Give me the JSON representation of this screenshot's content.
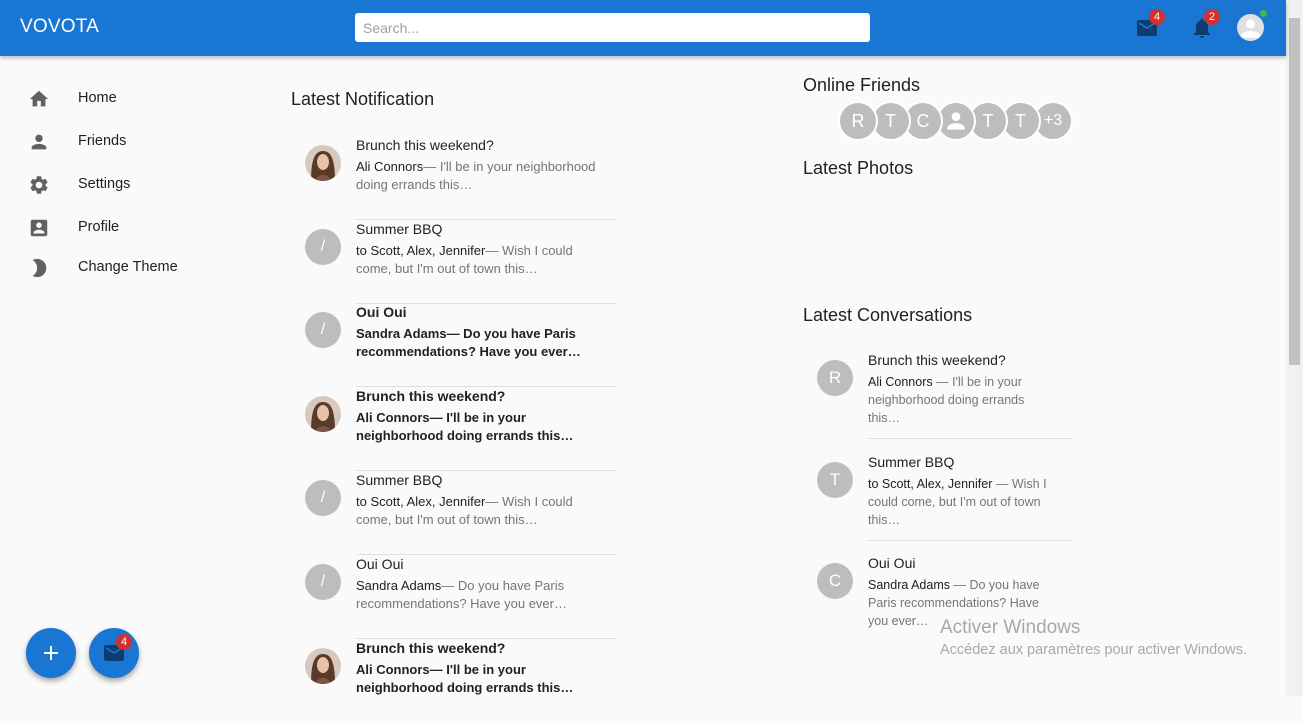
{
  "app": {
    "brand": "VOVOTA"
  },
  "search": {
    "placeholder": "Search..."
  },
  "header": {
    "mail_badge": "4",
    "notification_badge": "2"
  },
  "sidebar": {
    "items": [
      {
        "label": "Home",
        "icon": "home-icon"
      },
      {
        "label": "Friends",
        "icon": "person-icon"
      },
      {
        "label": "Settings",
        "icon": "gear-icon"
      },
      {
        "label": "Profile",
        "icon": "contact-card-icon"
      },
      {
        "label": "Change Theme",
        "icon": "moon-icon"
      }
    ]
  },
  "notifications": {
    "title": "Latest Notification",
    "items": [
      {
        "title": "Brunch this weekend?",
        "who": "Ali Connors",
        "text": "— I'll be in your neighborhood doing errands this…",
        "avatar": "photo",
        "bold": false
      },
      {
        "title": "Summer BBQ",
        "who": "to Scott, Alex, Jennifer",
        "text": "— Wish I could come, but I'm out of town this…",
        "avatar": "/",
        "bold": false
      },
      {
        "title": "Oui Oui",
        "who": "Sandra Adams",
        "text": "— Do you have Paris recommendations? Have you ever…",
        "avatar": "/",
        "bold": true
      },
      {
        "title": "Brunch this weekend?",
        "who": "Ali Connors",
        "text": "— I'll be in your neighborhood doing errands this…",
        "avatar": "photo",
        "bold": true
      },
      {
        "title": "Summer BBQ",
        "who": "to Scott, Alex, Jennifer",
        "text": "— Wish I could come, but I'm out of town this…",
        "avatar": "/",
        "bold": false
      },
      {
        "title": "Oui Oui",
        "who": "Sandra Adams",
        "text": "— Do you have Paris recommendations? Have you ever…",
        "avatar": "/",
        "bold": false
      },
      {
        "title": "Brunch this weekend?",
        "who": "Ali Connors",
        "text": "— I'll be in your neighborhood doing errands this…",
        "avatar": "photo",
        "bold": true
      }
    ]
  },
  "online_friends": {
    "title": "Online Friends",
    "avatars": [
      "R",
      "T",
      "C",
      "person-icon",
      "T",
      "T",
      "+3"
    ]
  },
  "photos": {
    "title": "Latest Photos"
  },
  "conversations": {
    "title": "Latest Conversations",
    "items": [
      {
        "letter": "R",
        "title": "Brunch this weekend?",
        "who": "Ali Connors",
        "text": " — I'll be in your neighborhood doing errands this…"
      },
      {
        "letter": "T",
        "title": "Summer BBQ",
        "who": "to Scott, Alex, Jennifer",
        "text": " — Wish I could come, but I'm out of town this…"
      },
      {
        "letter": "C",
        "title": "Oui Oui",
        "who": "Sandra Adams",
        "text": " — Do you have Paris recommendations? Have you ever…"
      }
    ]
  },
  "watermark": {
    "line1": "Activer Windows",
    "line2": "Accédez aux paramètres pour activer Windows."
  },
  "fab": {
    "mail_badge": "4"
  },
  "colors": {
    "primary": "#1976d2",
    "badge": "#d32f2f",
    "online": "#4caf50",
    "avatar_grey": "#bdbdbd"
  }
}
